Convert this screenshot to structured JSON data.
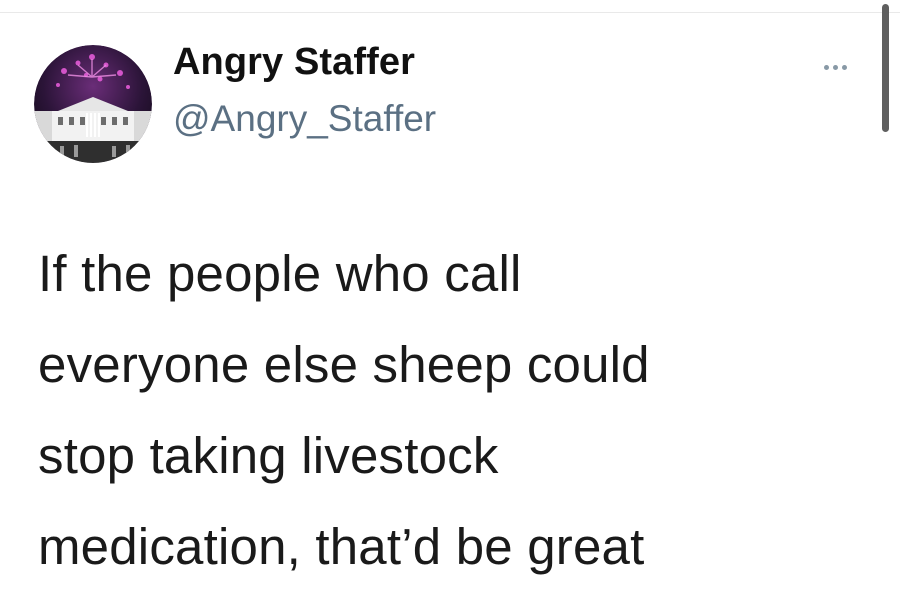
{
  "tweet": {
    "display_name": "Angry Staffer",
    "handle": "@Angry_Staffer",
    "lines": [
      "If the people who call",
      "everyone else sheep could",
      "stop taking livestock",
      "medication, that’d be great"
    ]
  },
  "icons": {
    "avatar": "white-house-fireworks-avatar",
    "more": "more-options-icon"
  },
  "colors": {
    "display_name": "#111111",
    "handle": "#5b7083",
    "text": "#1a1a1a",
    "more_dots": "#8899a6",
    "scrollbar": "#5f5f5f"
  }
}
